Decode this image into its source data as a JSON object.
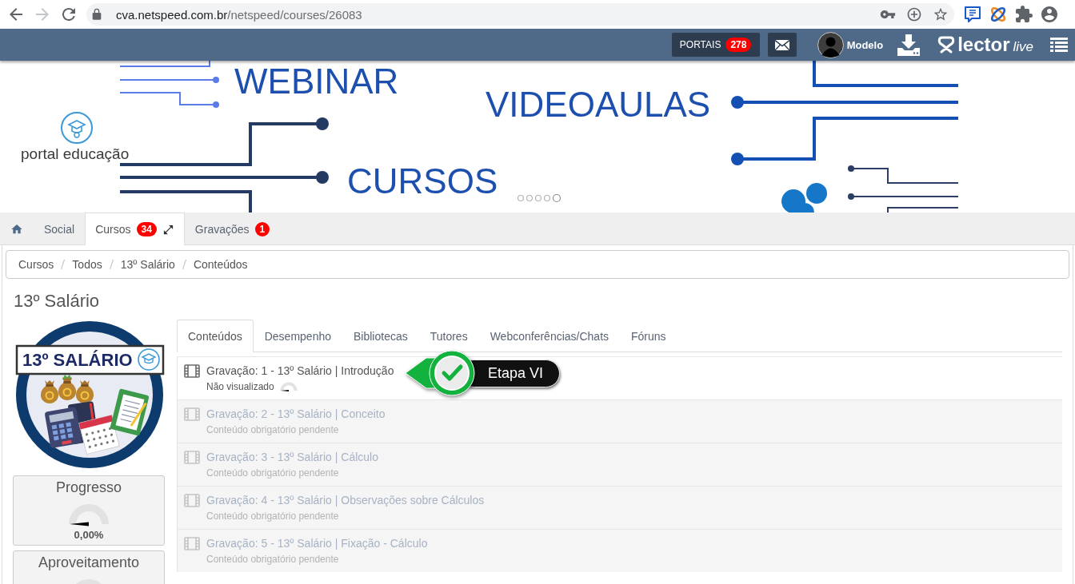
{
  "browser": {
    "nav": [
      {
        "kind": "back",
        "disabled": false
      },
      {
        "kind": "forward",
        "disabled": true
      },
      {
        "kind": "reload",
        "disabled": false
      }
    ],
    "url_host": "cva.netspeed.com.br",
    "url_path": "/netspeed/courses/26083"
  },
  "header": {
    "portals": {
      "label": "PORTAIS",
      "count": "278"
    },
    "user": {
      "name": "Modelo"
    },
    "logo": {
      "brand": "lector",
      "suffix": "live"
    }
  },
  "banner": {
    "headings": [
      "WEBINAR",
      "VIDEOAULAS",
      "CURSOS"
    ],
    "portal_name": "portal educação",
    "dots": [
      {
        "selected": false
      },
      {
        "selected": false
      },
      {
        "selected": false
      },
      {
        "selected": false
      },
      {
        "selected": true
      }
    ]
  },
  "main_tabs": [
    {
      "kind": "home",
      "selected": false
    },
    {
      "kind": "text",
      "label": "Social",
      "selected": false,
      "expandable": false
    },
    {
      "kind": "text",
      "label": "Cursos",
      "badge": "34",
      "expandable": true,
      "selected": true
    },
    {
      "kind": "text",
      "label": "Gravações",
      "badge": "1",
      "expandable": false,
      "selected": false
    }
  ],
  "breadcrumb": [
    "Cursos",
    "Todos",
    "13º Salário",
    "Conteúdos"
  ],
  "course": {
    "title": "13º Salário",
    "image_title": "13º SALÁRIO",
    "progress": {
      "label": "Progresso",
      "value": "0,00%"
    },
    "performance": {
      "label": "Aproveitamento"
    }
  },
  "content_tabs": [
    {
      "label": "Conteúdos",
      "selected": true
    },
    {
      "label": "Desempenho",
      "selected": false
    },
    {
      "label": "Bibliotecas",
      "selected": false
    },
    {
      "label": "Tutores",
      "selected": false
    },
    {
      "label": "Webconferências/Chats",
      "selected": false
    },
    {
      "label": "Fóruns",
      "selected": false
    }
  ],
  "contents": [
    {
      "title": "Gravação: 1 - 13º Salário | Introdução",
      "status": "Não visualizado",
      "disabled": false
    },
    {
      "title": "Gravação: 2 - 13º Salário | Conceito",
      "status": "Conteúdo obrigatório pendente",
      "disabled": true
    },
    {
      "title": "Gravação: 3 - 13º Salário | Cálculo",
      "status": "Conteúdo obrigatório pendente",
      "disabled": true
    },
    {
      "title": "Gravação: 4 - 13º Salário | Observações sobre Cálculos",
      "status": "Conteúdo obrigatório pendente",
      "disabled": true
    },
    {
      "title": "Gravação: 5 - 13º Salário | Fixação - Cálculo",
      "status": "Conteúdo obrigatório pendente",
      "disabled": true
    }
  ],
  "stage_badge": {
    "label": "Etapa VI"
  }
}
